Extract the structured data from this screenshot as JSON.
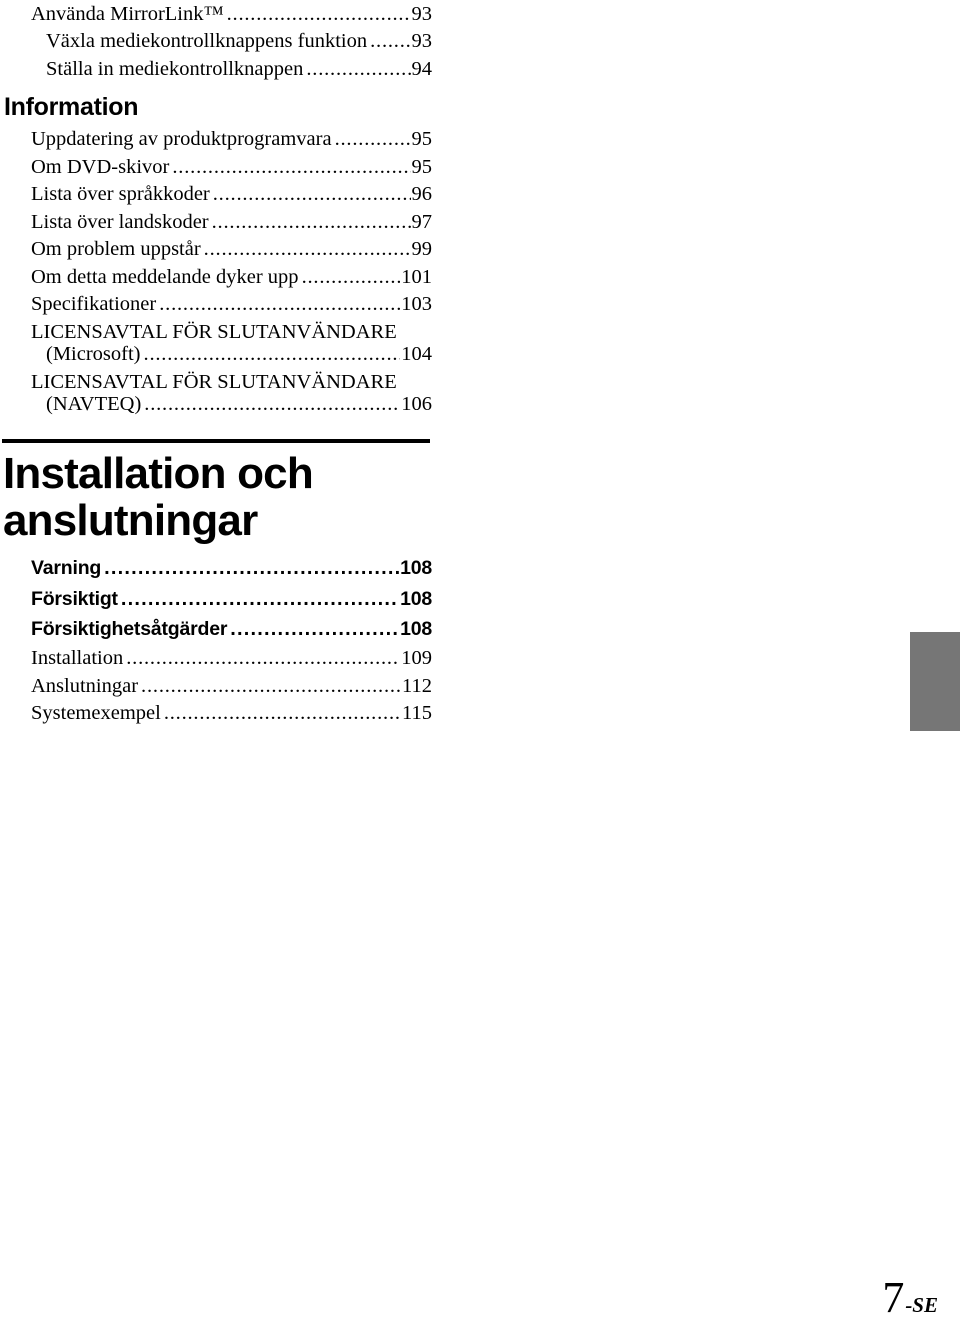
{
  "document": {
    "page_label": "7",
    "page_suffix": "-SE",
    "thumb_tab_color": "#767676"
  },
  "leader": "..................................................................................................",
  "toc": {
    "top_entries": [
      {
        "title": "Använda MirrorLink™",
        "page": "93",
        "indent": 1,
        "style": "serif"
      },
      {
        "title": "Växla mediekontrollknappens funktion",
        "page": "93",
        "indent": 2,
        "style": "serif"
      },
      {
        "title": "Ställa in mediekontrollknappen",
        "page": "94",
        "indent": 2,
        "style": "serif"
      }
    ],
    "sections": [
      {
        "heading": "Information",
        "heading_style": "small-bold-sans",
        "entries": [
          {
            "title": "Uppdatering av produktprogramvara",
            "page": "95",
            "indent": 1,
            "style": "serif"
          },
          {
            "title": "Om DVD-skivor",
            "page": "95",
            "indent": 1,
            "style": "serif"
          },
          {
            "title": "Lista över språkkoder",
            "page": "96",
            "indent": 1,
            "style": "serif"
          },
          {
            "title": "Lista över landskoder",
            "page": "97",
            "indent": 1,
            "style": "serif"
          },
          {
            "title": "Om problem uppstår",
            "page": "99",
            "indent": 1,
            "style": "serif"
          },
          {
            "title": "Om detta meddelande dyker upp",
            "page": "101",
            "indent": 1,
            "style": "serif"
          },
          {
            "title": "Specifikationer",
            "page": "103",
            "indent": 1,
            "style": "serif"
          },
          {
            "title_line1": "LICENSAVTAL FÖR SLUTANVÄNDARE",
            "title": "(Microsoft)",
            "page": "104",
            "indent": 1,
            "style": "serif-wrapped"
          },
          {
            "title_line1": "LICENSAVTAL FÖR SLUTANVÄNDARE",
            "title": "(NAVTEQ)",
            "page": "106",
            "indent": 1,
            "style": "serif-wrapped"
          }
        ]
      },
      {
        "heading": "Installation och\nanslutningar",
        "heading_style": "chapter",
        "entries": [
          {
            "title": "Varning",
            "page": "108",
            "indent": 1,
            "style": "bold-sans"
          },
          {
            "title": "Försiktigt",
            "page": "108",
            "indent": 1,
            "style": "bold-sans"
          },
          {
            "title": "Försiktighetsåtgärder",
            "page": "108",
            "indent": 1,
            "style": "bold-sans"
          },
          {
            "title": "Installation",
            "page": "109",
            "indent": 1,
            "style": "serif"
          },
          {
            "title": "Anslutningar",
            "page": "112",
            "indent": 1,
            "style": "serif"
          },
          {
            "title": "Systemexempel",
            "page": "115",
            "indent": 1,
            "style": "serif"
          }
        ]
      }
    ]
  }
}
